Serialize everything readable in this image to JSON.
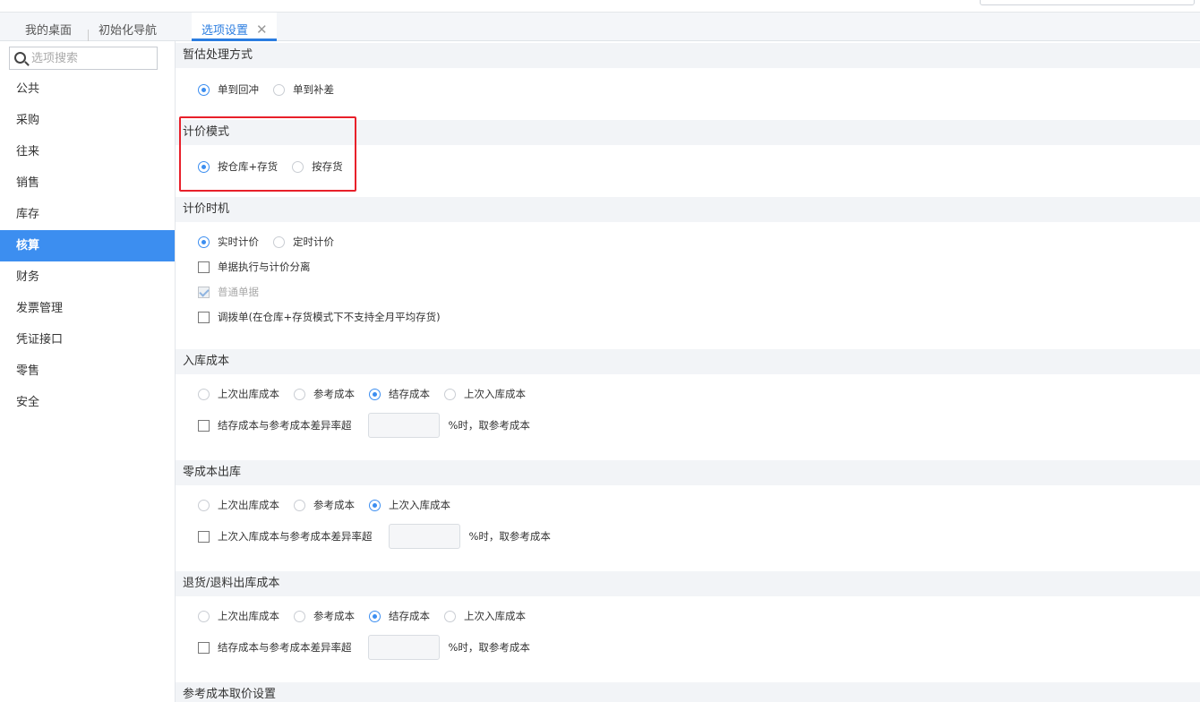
{
  "tabs": [
    {
      "label": "我的桌面"
    },
    {
      "label": "初始化导航"
    },
    {
      "label": "选项设置",
      "close": "✕"
    }
  ],
  "sidebar": {
    "search_placeholder": "选项搜索",
    "items": [
      {
        "label": "公共"
      },
      {
        "label": "采购"
      },
      {
        "label": "往来"
      },
      {
        "label": "销售"
      },
      {
        "label": "库存"
      },
      {
        "label": "核算",
        "active": true
      },
      {
        "label": "财务"
      },
      {
        "label": "发票管理"
      },
      {
        "label": "凭证接口"
      },
      {
        "label": "零售"
      },
      {
        "label": "安全"
      }
    ]
  },
  "sections": {
    "estimate": {
      "title": "暂估处理方式",
      "options": [
        "单到回冲",
        "单到补差"
      ],
      "selected": "单到回冲"
    },
    "pricing_mode": {
      "title": "计价模式",
      "options": [
        "按仓库+存货",
        "按存货"
      ],
      "selected": "按仓库+存货"
    },
    "pricing_timing": {
      "title": "计价时机",
      "options": [
        "实时计价",
        "定时计价"
      ],
      "selected": "实时计价",
      "checks": [
        {
          "label": "单据执行与计价分离",
          "checked": false,
          "disabled": false
        },
        {
          "label": "普通单据",
          "checked": true,
          "disabled": true
        },
        {
          "label": "调拨单(在仓库+存货模式下不支持全月平均存货)",
          "checked": false,
          "disabled": false
        }
      ]
    },
    "inbound_cost": {
      "title": "入库成本",
      "options": [
        "上次出库成本",
        "参考成本",
        "结存成本",
        "上次入库成本"
      ],
      "selected": "结存成本",
      "check_label": "结存成本与参考成本差异率超",
      "input_value": "",
      "suffix": "%时，取参考成本"
    },
    "zero_cost": {
      "title": "零成本出库",
      "options": [
        "上次出库成本",
        "参考成本",
        "上次入库成本"
      ],
      "selected": "上次入库成本",
      "check_label": "上次入库成本与参考成本差异率超",
      "input_value": "",
      "suffix": "%时，取参考成本"
    },
    "return_cost": {
      "title": "退货/退料出库成本",
      "options": [
        "上次出库成本",
        "参考成本",
        "结存成本",
        "上次入库成本"
      ],
      "selected": "结存成本",
      "check_label": "结存成本与参考成本差异率超",
      "input_value": "",
      "suffix": "%时，取参考成本"
    },
    "reference_cost": {
      "title": "参考成本取价设置"
    }
  },
  "colors": {
    "accent": "#3c8ef0",
    "highlight": "#e8202a"
  }
}
